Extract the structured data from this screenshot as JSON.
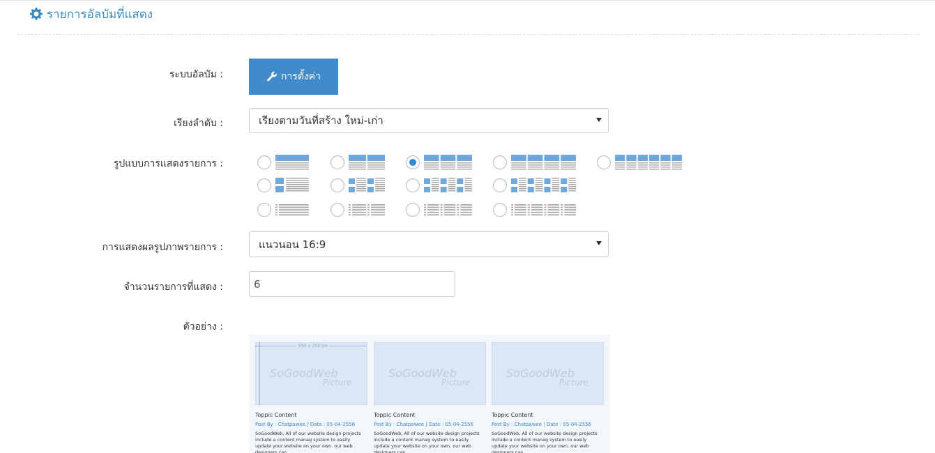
{
  "header": {
    "title": "รายการอัลบัมที่แสดง",
    "icon": "gear-icon"
  },
  "form": {
    "album_system": {
      "label": "ระบบอัลบัม :",
      "button_label": "การตั้งค่า",
      "button_icon": "wrench-icon"
    },
    "sort": {
      "label": "เรียงลำดับ :",
      "value": "เรียงตามวันที่สร้าง ใหม่-เก่า"
    },
    "layout": {
      "label": "รูปแบบการแสดงรายการ :",
      "selected_option": 3,
      "option_count": 13
    },
    "image_display": {
      "label": "การแสดงผลรูปภาพรายการ :",
      "value": "แนวนอน 16:9"
    },
    "item_count": {
      "label": "จำนวนรายการที่แสดง :",
      "value": "6"
    },
    "example": {
      "label": "ตัวอย่าง :"
    }
  },
  "preview": {
    "dimension_label": "330 x 200 px",
    "watermark_main": "SoGoodWeb",
    "watermark_sub": "Picture",
    "cards": [
      {
        "title": "Toppic Content",
        "meta": "Post By : Chatpawee  |  Date : 05-04-2556",
        "desc": "SoGoodWeb, All of our website design projects include a content manag system to easily update your website on your own. our web designers can"
      },
      {
        "title": "Toppic Content",
        "meta": "Post By : Chatpawee  |  Date : 05-04-2556",
        "desc": "SoGoodWeb, All of our website design projects include a content manag system to easily update your website on your own. our web designers can"
      },
      {
        "title": "Toppic Content",
        "meta": "Post By : Chatpawee  |  Date : 05-04-2556",
        "desc": "SoGoodWeb, All of our website design projects include a content manag system to easily update your website on your own. our web designers can"
      }
    ]
  },
  "colors": {
    "accent": "#3c8dbc",
    "button": "#428bca",
    "thumb_blue": "#6fa8dc",
    "thumb_gray": "#a9a9a9"
  }
}
